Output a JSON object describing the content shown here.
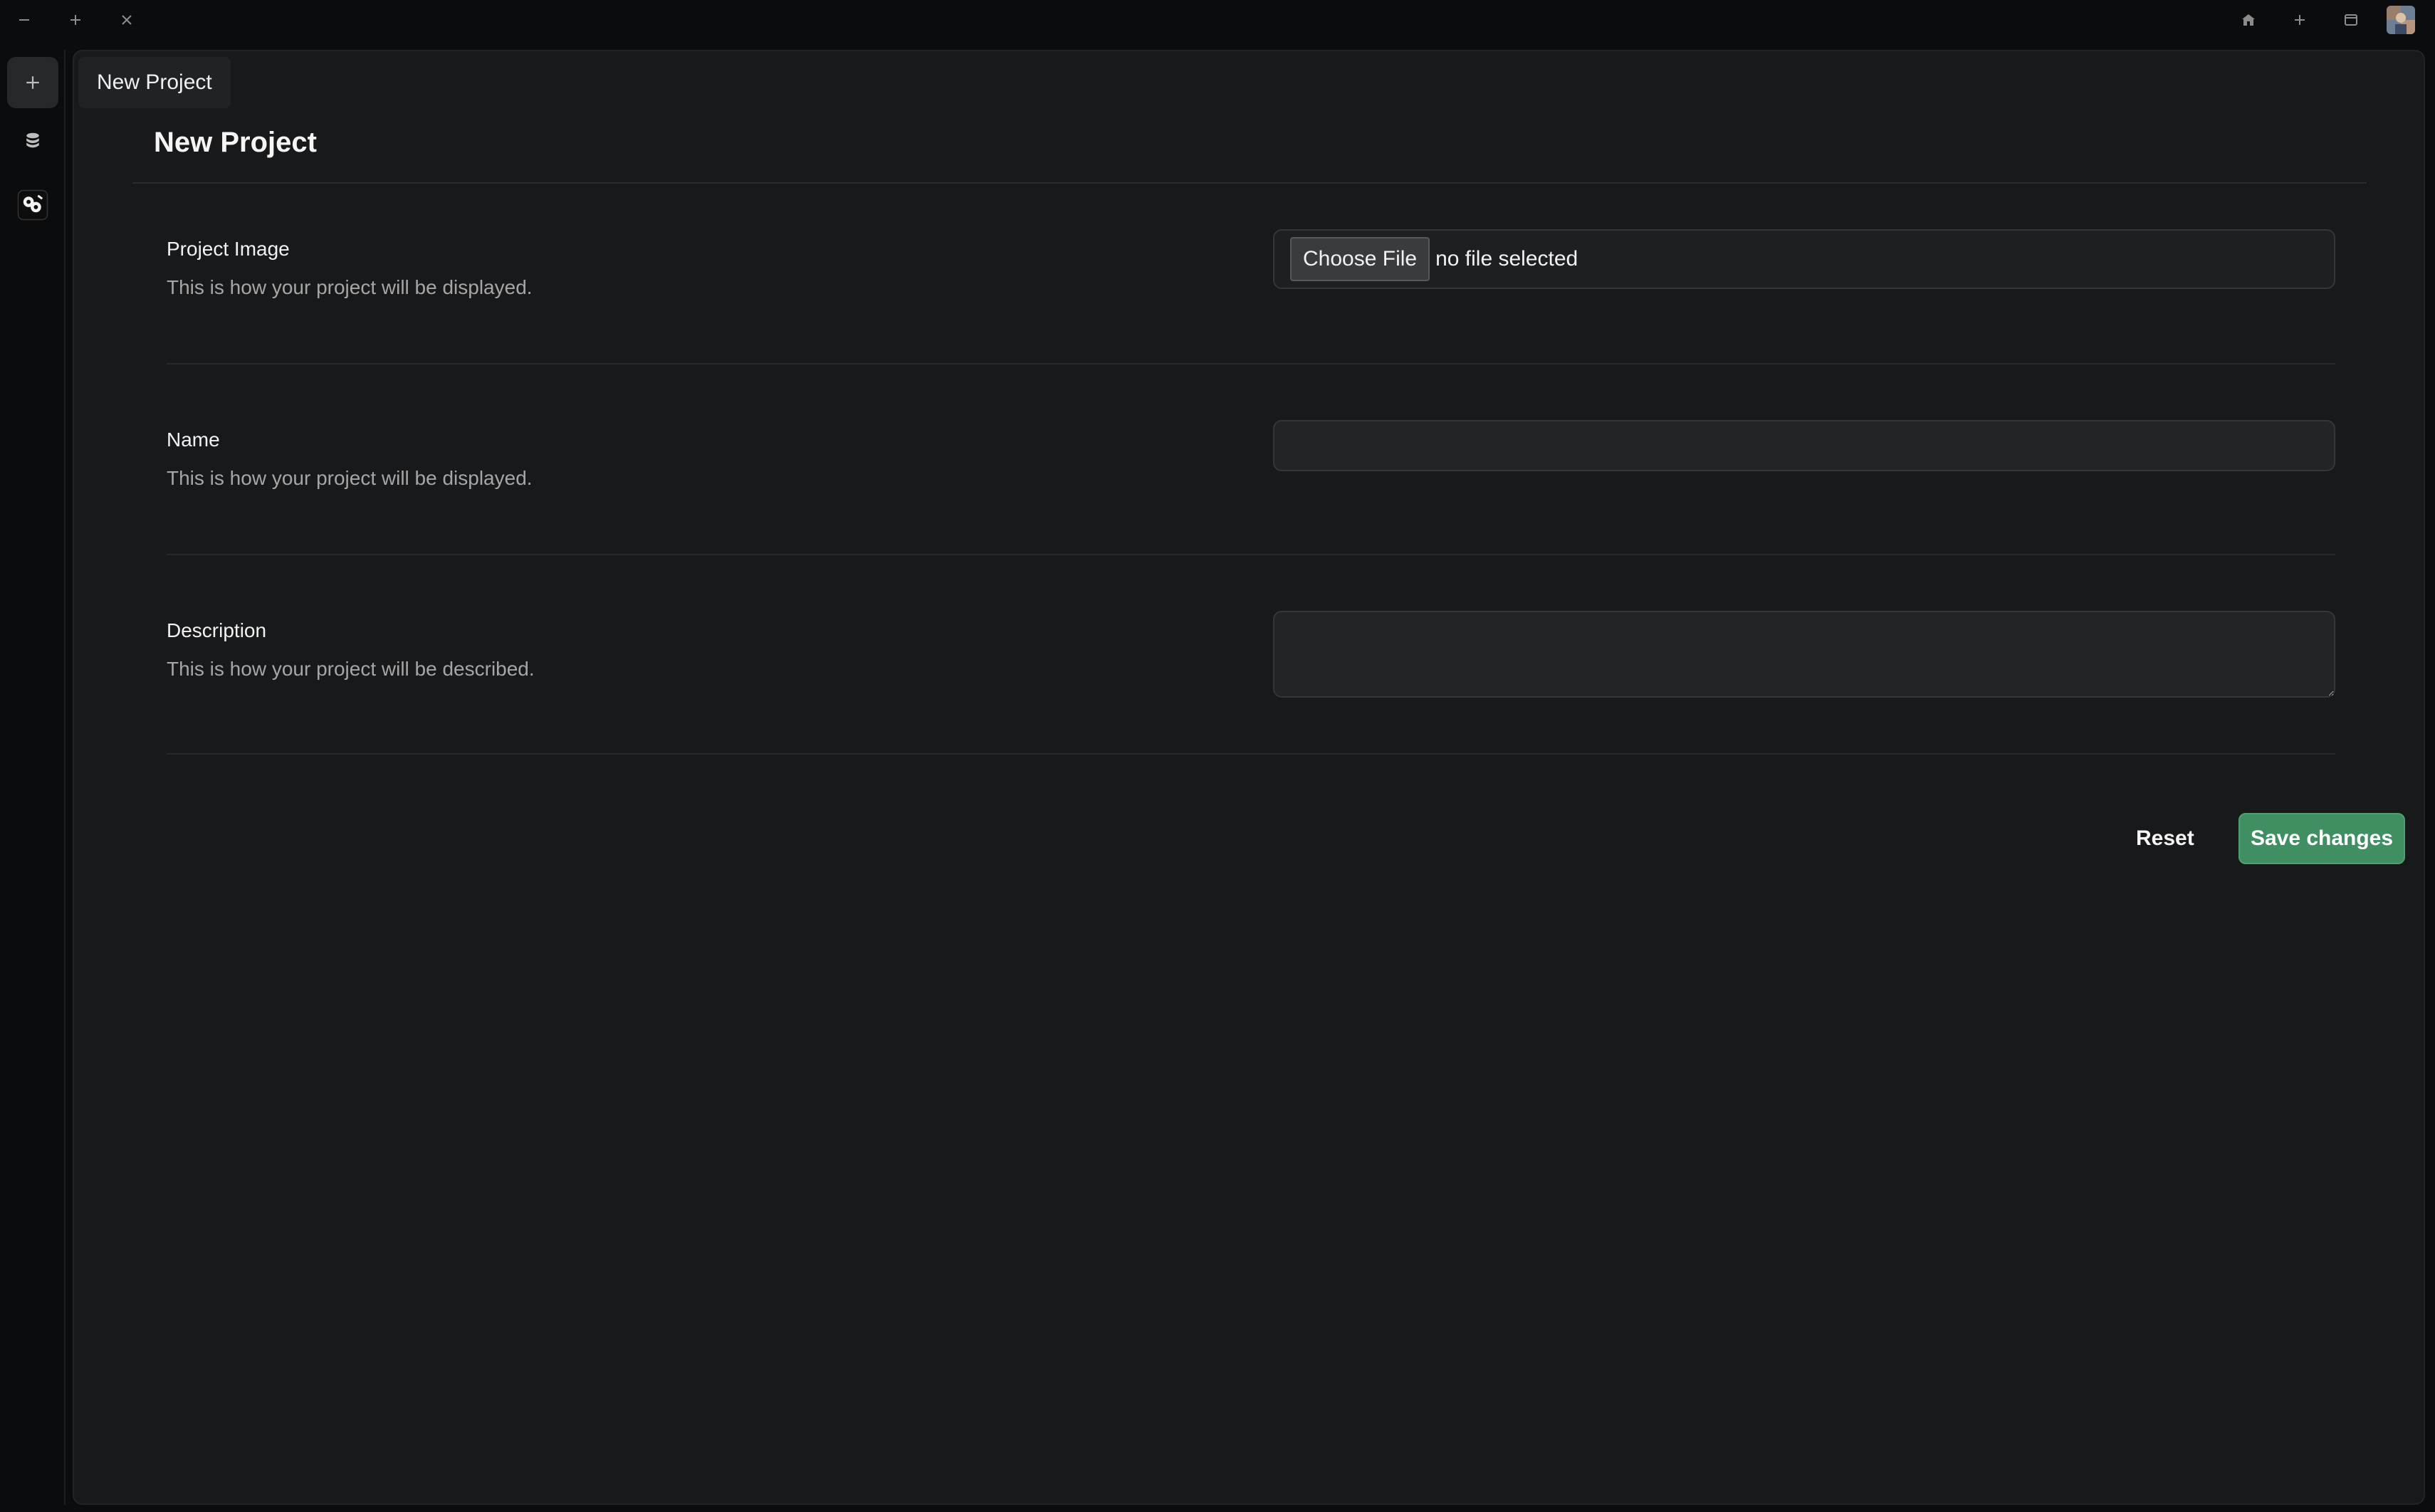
{
  "app": {
    "tooltip": "New Project"
  },
  "page": {
    "title": "New Project"
  },
  "form": {
    "project_image": {
      "label": "Project Image",
      "help": "This is how your project will be displayed.",
      "choose_file_label": "Choose File",
      "file_status": "no file selected"
    },
    "name": {
      "label": "Name",
      "help": "This is how your project will be displayed.",
      "value": ""
    },
    "description": {
      "label": "Description",
      "help": "This is how your project will be described.",
      "value": ""
    },
    "reset_label": "Reset",
    "save_label": "Save changes"
  },
  "colors": {
    "accent_green": "#3f8f62",
    "panel_bg": "#18191b",
    "app_bg": "#0b0c0e"
  },
  "icons": {
    "titlebar_left": [
      "minimize-icon",
      "plus-icon",
      "close-icon"
    ],
    "titlebar_right": [
      "home-icon",
      "plus-icon",
      "window-icon",
      "avatar"
    ],
    "rail": [
      "plus-icon",
      "database-icon",
      "logo-icon"
    ]
  }
}
